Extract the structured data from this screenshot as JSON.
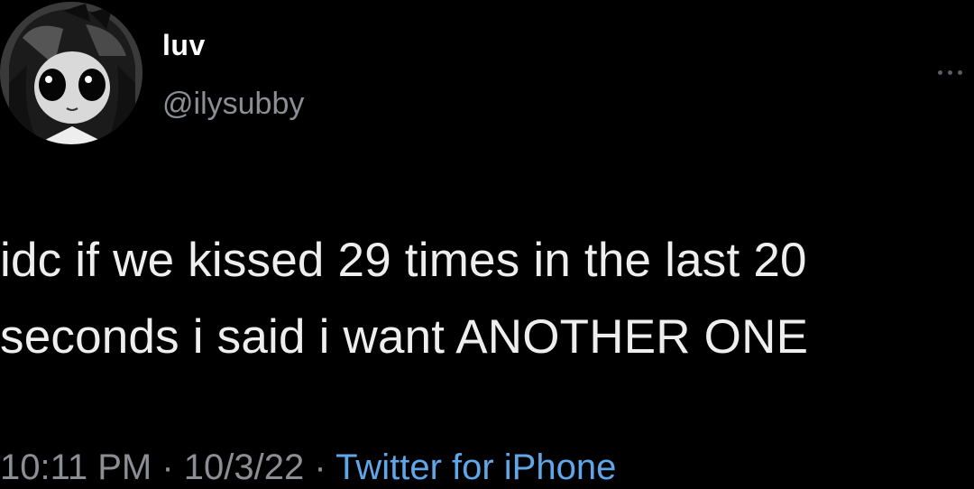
{
  "tweet": {
    "author": {
      "display_name": "luv",
      "handle": "@ilysubby",
      "avatar_icon": "anime-avatar-icon"
    },
    "more_icon": "more-horizontal-icon",
    "text": "idc if we kissed 29 times in the last 20\nseconds i said i want ANOTHER ONE",
    "meta": {
      "time": "10:11 PM",
      "separator": " · ",
      "date": "10/3/22",
      "source": "Twitter for iPhone"
    }
  },
  "colors": {
    "background": "#000000",
    "text": "#e7e9ea",
    "secondary": "#8b8f94",
    "link": "#5fa7e8"
  }
}
